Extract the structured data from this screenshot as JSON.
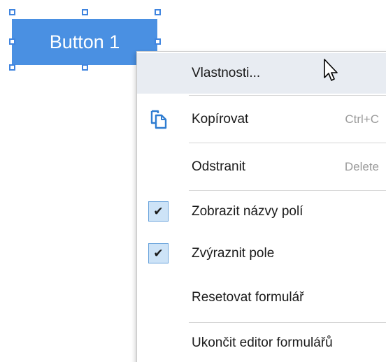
{
  "form_button": {
    "label": "Button 1"
  },
  "context_menu": {
    "items": [
      {
        "label": "Vlastnosti...",
        "shortcut": "",
        "icon": "",
        "checked": false,
        "highlighted": true
      },
      {
        "label": "Kopírovat",
        "shortcut": "Ctrl+C",
        "icon": "copy-icon",
        "checked": false,
        "highlighted": false
      },
      {
        "label": "Odstranit",
        "shortcut": "Delete",
        "icon": "",
        "checked": false,
        "highlighted": false
      },
      {
        "label": "Zobrazit názvy polí",
        "shortcut": "",
        "icon": "",
        "checked": true,
        "highlighted": false
      },
      {
        "label": "Zvýraznit pole",
        "shortcut": "",
        "icon": "",
        "checked": true,
        "highlighted": false
      },
      {
        "label": "Resetovat formulář",
        "shortcut": "",
        "icon": "",
        "checked": false,
        "highlighted": false
      },
      {
        "label": "Ukončit editor formulářů",
        "shortcut": "",
        "icon": "",
        "checked": false,
        "highlighted": false
      }
    ],
    "check_glyph": "✔"
  },
  "colors": {
    "button_fill": "#4a90e2",
    "selection_handle": "#3f84df",
    "menu_highlight": "#e8ecf2",
    "checkbox_fill": "#cde3f7"
  },
  "cursor": "arrow-pointer-icon"
}
